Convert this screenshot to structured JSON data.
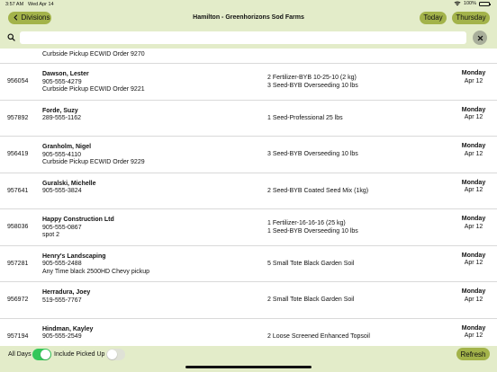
{
  "status_bar": {
    "time": "3:57 AM",
    "date": "Wed Apr 14",
    "battery": "100%"
  },
  "nav": {
    "back_label": "Divisions",
    "title": "Hamilton - Greenhorizons Sod Farms",
    "today_label": "Today",
    "day_label": "Thursday"
  },
  "search": {
    "value": "",
    "placeholder": ""
  },
  "partial_row": {
    "line": "Curbside Pickup ECWID Order 9270"
  },
  "rows": [
    {
      "order": "956054",
      "name": "Dawson, Lester",
      "phone": "905-555-4279",
      "note": "Curbside Pickup ECWID Order 9221",
      "items": [
        "2 Fertilizer-BYB 10-25-10 (2 kg)",
        "3 Seed-BYB Overseeding 10 lbs"
      ],
      "day": "Monday",
      "date": "Apr 12"
    },
    {
      "order": "957892",
      "name": "Forde, Suzy",
      "phone": "289-555-1162",
      "note": "",
      "items": [
        "1 Seed-Professional 25 lbs"
      ],
      "day": "Monday",
      "date": "Apr 12"
    },
    {
      "order": "956419",
      "name": "Granholm, Nigel",
      "phone": "905-555-4110",
      "note": "Curbside Pickup ECWID Order 9229",
      "items": [
        "3 Seed-BYB Overseeding 10 lbs"
      ],
      "day": "Monday",
      "date": "Apr 12"
    },
    {
      "order": "957641",
      "name": "Guralski, Michelle",
      "phone": "905-555-3824",
      "note": "",
      "items": [
        "2 Seed-BYB Coated Seed Mix (1kg)"
      ],
      "day": "Monday",
      "date": "Apr 12"
    },
    {
      "order": "958036",
      "name": "Happy Construction Ltd",
      "phone": "905-555-0867",
      "note": "spot 2",
      "items": [
        "1 Fertilizer-16-16-16 (25 kg)",
        "1 Seed-BYB Overseeding 10 lbs"
      ],
      "day": "Monday",
      "date": "Apr 12"
    },
    {
      "order": "957281",
      "name": "Henry's Landscaping",
      "phone": "905-555-2488",
      "note": "Any Time  black 2500HD Chevy pickup",
      "items": [
        "5 Small Tote Black Garden Soil"
      ],
      "day": "Monday",
      "date": "Apr 12"
    },
    {
      "order": "956972",
      "name": "Herradura, Joey",
      "phone": "519-555-7767",
      "note": "",
      "items": [
        "2 Small Tote Black Garden Soil"
      ],
      "day": "Monday",
      "date": "Apr 12"
    },
    {
      "order": "957194",
      "name": "Hindman, Kayley",
      "phone": "905-555-2549",
      "note": "",
      "items": [
        "2 Loose Screened Enhanced Topsoil"
      ],
      "day": "Monday",
      "date": "Apr 12"
    }
  ],
  "bottom": {
    "all_days_label": "All Days",
    "all_days_on": true,
    "include_picked_up_label": "Include Picked Up",
    "include_picked_up_on": false,
    "refresh_label": "Refresh"
  },
  "colors": {
    "bar_bg": "#e3ecc9",
    "pill": "#a3b34a",
    "toggle_on": "#34c759"
  }
}
